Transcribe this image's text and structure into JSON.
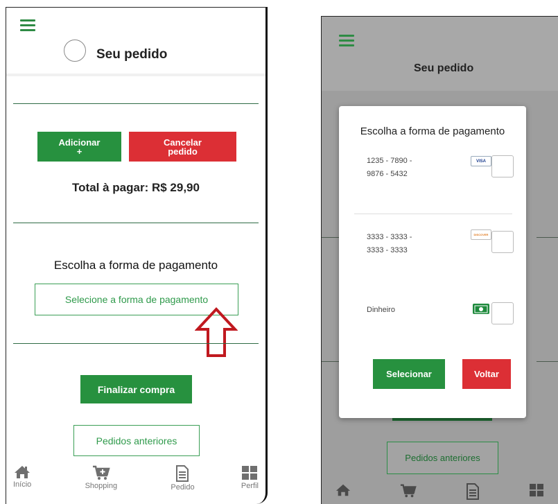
{
  "left_screen": {
    "header": {
      "title": "Seu pedido"
    },
    "buttons": {
      "add_label_line1": "Adicionar",
      "add_label_line2": "+",
      "cancel_label_line1": "Cancelar",
      "cancel_label_line2": "pedido"
    },
    "total_label": "Total à pagar: R$ 29,90",
    "payment_title": "Escolha a forma de pagamento",
    "select_payment_label": "Selecione a forma de pagamento",
    "finalize_label": "Finalizar compra",
    "history_label": "Pedidos anteriores",
    "nav": [
      {
        "label": "Início",
        "icon": "home-icon"
      },
      {
        "label": "Shopping",
        "icon": "cart-icon"
      },
      {
        "label": "Pedido",
        "icon": "document-icon"
      },
      {
        "label": "Perfil",
        "icon": "grid-icon"
      }
    ]
  },
  "right_screen": {
    "header": {
      "title": "Seu pedido"
    },
    "modal": {
      "title": "Escolha a forma de pagamento",
      "options": [
        {
          "line1": "1235 - 7890 -",
          "line2": "9876 - 5432",
          "logo": "VISA",
          "icon": "visa-card-icon"
        },
        {
          "line1": "3333 - 3333 -",
          "line2": "3333 - 3333",
          "logo": "DISCOVER",
          "icon": "discover-card-icon"
        },
        {
          "line1": "Dinheiro",
          "line2": "",
          "logo": "",
          "icon": "cash-icon"
        }
      ],
      "select_label": "Selecionar",
      "back_label": "Voltar"
    },
    "history_label": "Pedidos anteriores"
  },
  "colors": {
    "green": "#27913f",
    "red": "#dc2f35",
    "annotation_arrow": "#c0191f"
  }
}
